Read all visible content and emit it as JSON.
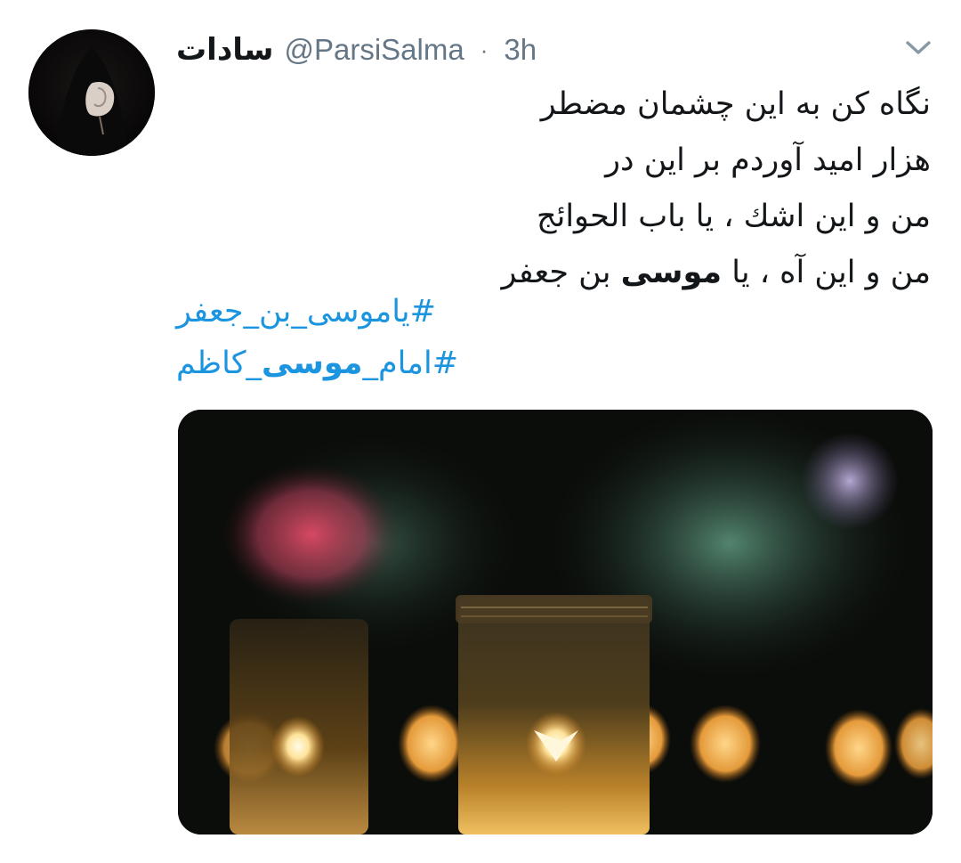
{
  "tweet": {
    "author": {
      "display_name": "سادات",
      "handle": "@ParsiSalma",
      "avatar_icon": "avatar-photo-icon"
    },
    "separator": "·",
    "timestamp": "3h",
    "menu_icon": "chevron-down-icon",
    "text_lines": [
      "نگاه کن به این چشمان مضطر",
      "هزار امید آوردم بر این در",
      "من و این اشك ، یا باب الحوائج",
      {
        "before": "من و این آه ، یا ",
        "bold": "موسی",
        "after": " بن جعفر"
      }
    ],
    "hashtags": [
      {
        "before": "#یاموسی_بن_جعفر",
        "bold": "",
        "after": ""
      },
      {
        "before": "#امام_",
        "bold": "موسی",
        "after": "_کاظم"
      }
    ],
    "media": {
      "type": "photo",
      "icon": "candles-photo-icon"
    }
  },
  "colors": {
    "text": "#14171a",
    "secondary": "#657786",
    "link": "#1b95e0",
    "background": "#ffffff"
  }
}
